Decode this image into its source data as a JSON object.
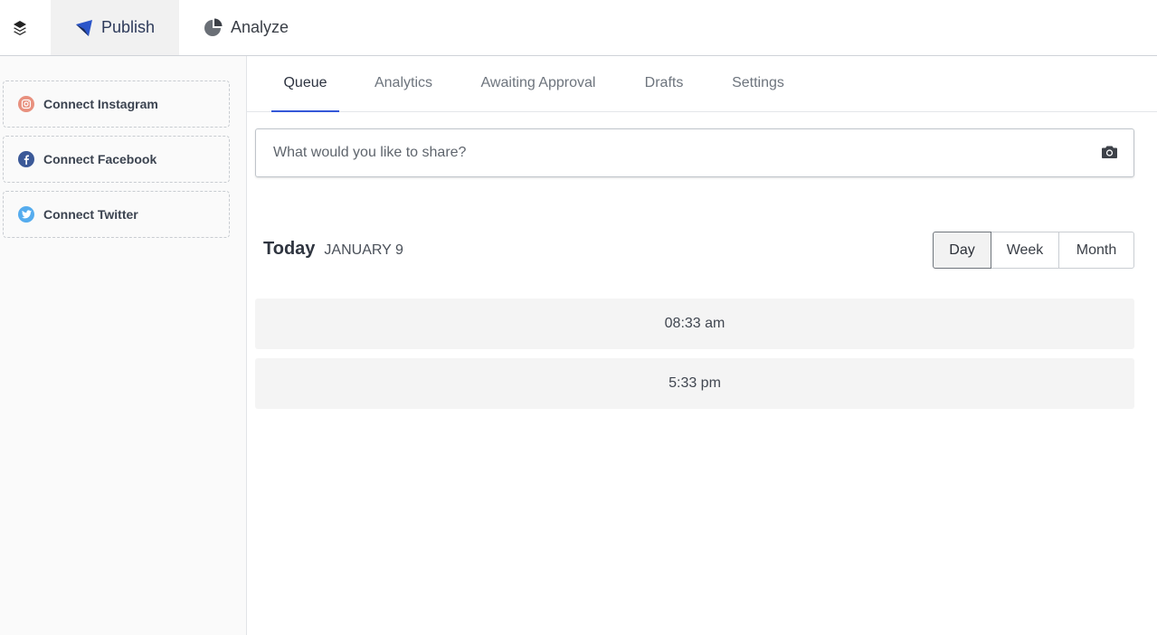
{
  "topbar": {
    "logo_icon": "layers-icon",
    "tabs": [
      {
        "label": "Publish",
        "icon": "publish-logo-icon",
        "active": true
      },
      {
        "label": "Analyze",
        "icon": "pie-chart-icon",
        "active": false
      }
    ]
  },
  "sidebar": {
    "connect_items": [
      {
        "label": "Connect Instagram",
        "icon": "instagram-icon",
        "color": "#d9534f"
      },
      {
        "label": "Connect Facebook",
        "icon": "facebook-icon",
        "color": "#3b5998"
      },
      {
        "label": "Connect Twitter",
        "icon": "twitter-icon",
        "color": "#55acee"
      }
    ]
  },
  "main": {
    "tabs": [
      {
        "label": "Queue",
        "active": true
      },
      {
        "label": "Analytics",
        "active": false
      },
      {
        "label": "Awaiting Approval",
        "active": false
      },
      {
        "label": "Drafts",
        "active": false
      },
      {
        "label": "Settings",
        "active": false
      }
    ],
    "composer": {
      "placeholder": "What would you like to share?",
      "value": "",
      "icon": "camera-icon"
    },
    "day": {
      "title": "Today",
      "date": "JANUARY 9"
    },
    "view_toggle": [
      {
        "label": "Day",
        "active": true
      },
      {
        "label": "Week",
        "active": false
      },
      {
        "label": "Month",
        "active": false
      }
    ],
    "slots": [
      {
        "time": "08:33 am"
      },
      {
        "time": "5:33 pm"
      }
    ]
  },
  "colors": {
    "accent": "#3458d8",
    "publish_tab_bg": "#f1f1f1",
    "sidebar_bg": "#fafafa",
    "slot_bg": "#f4f4f4"
  }
}
